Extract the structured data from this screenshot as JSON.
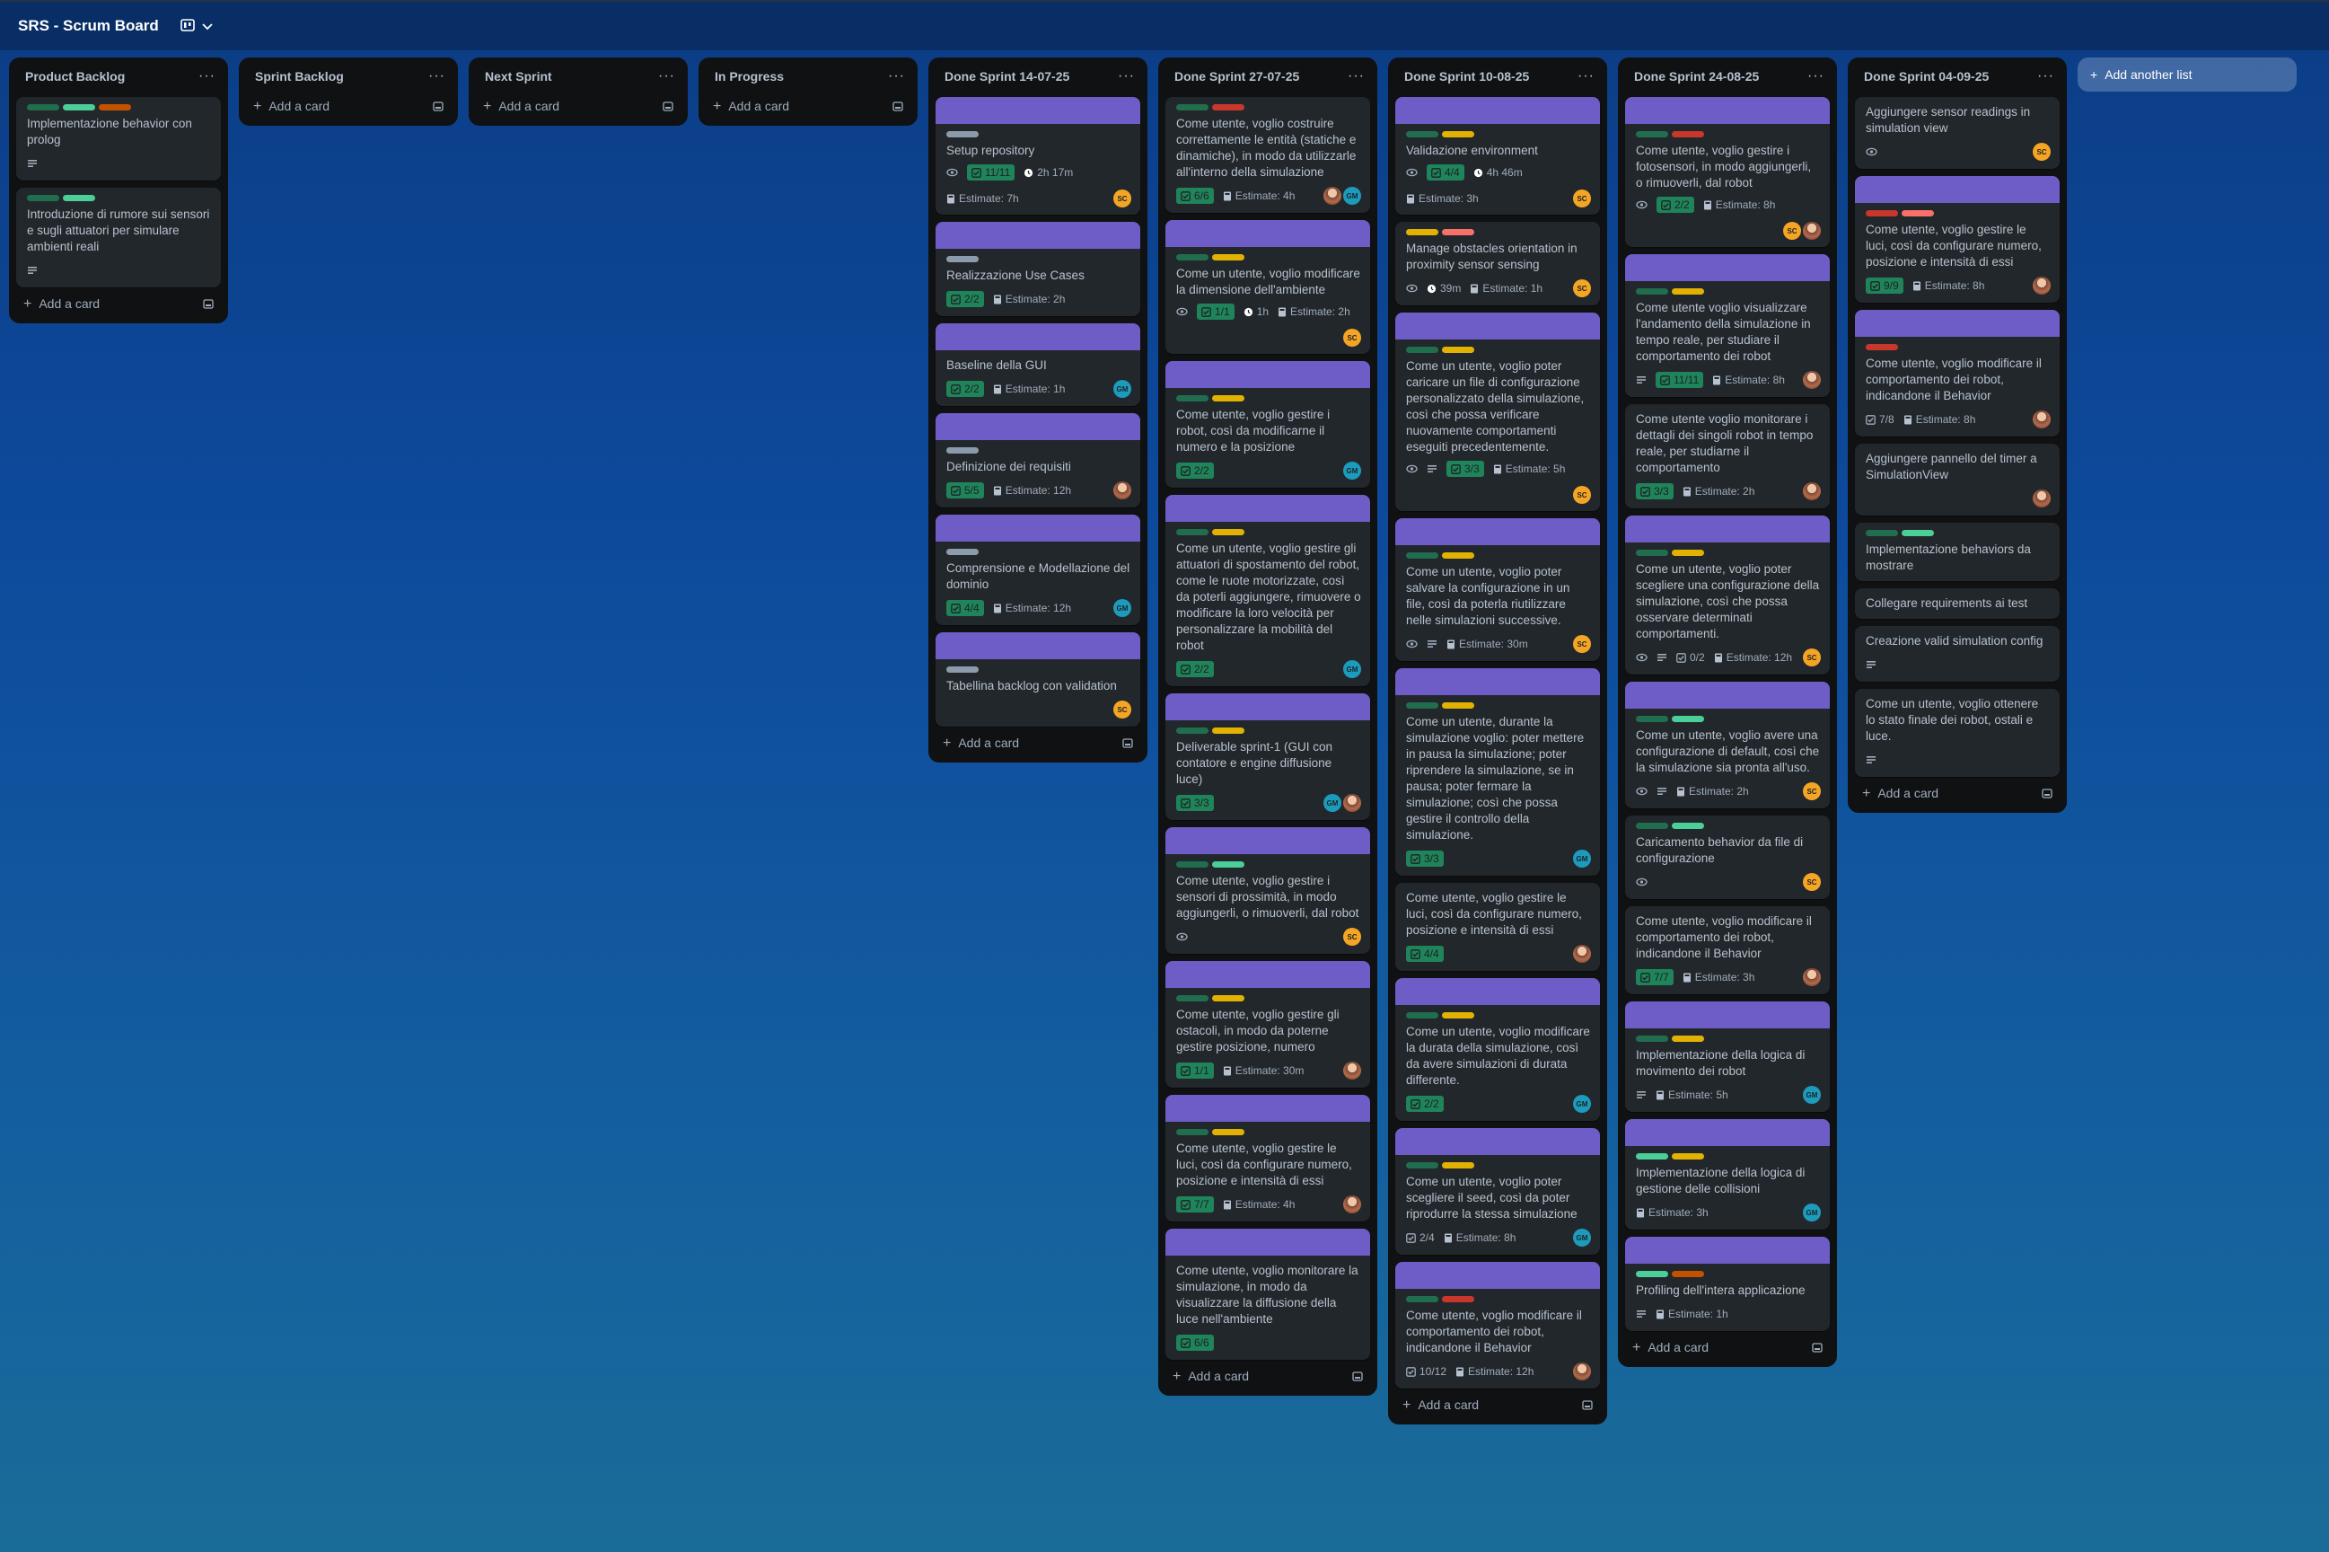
{
  "board": {
    "title": "SRS - Scrum Board",
    "view_icon": "board-icon",
    "chevron": "chevron-down-icon"
  },
  "add_card_label": "Add a card",
  "add_list_label": "Add another list",
  "estimate_prefix": "Estimate: ",
  "members": {
    "SC": {
      "initials": "SC",
      "color": "#f5a524"
    },
    "GM": {
      "initials": "GM",
      "color": "#1d9bbd"
    }
  },
  "lists": [
    {
      "title": "Product Backlog",
      "cards": [
        {
          "labels": [
            "green-d",
            "green",
            "orange"
          ],
          "title": "Implementazione behavior con prolog",
          "desc": true
        },
        {
          "labels": [
            "green-d",
            "green"
          ],
          "title": "Introduzione di rumore sui sensori e sugli attuatori per simulare ambienti reali",
          "desc": true
        }
      ]
    },
    {
      "title": "Sprint Backlog",
      "cards": []
    },
    {
      "title": "Next Sprint",
      "cards": []
    },
    {
      "title": "In Progress",
      "cards": []
    },
    {
      "title": "Done Sprint 14-07-25",
      "cards": [
        {
          "cover": true,
          "labels": [
            "gray"
          ],
          "title": "Setup repository",
          "watch": true,
          "checklist": "11/11",
          "time": "2h 17m",
          "estimate": "7h",
          "members": [
            "SC"
          ]
        },
        {
          "cover": true,
          "labels": [
            "gray"
          ],
          "title": "Realizzazione Use Cases",
          "checklist": "2/2",
          "estimate": "2h"
        },
        {
          "cover": true,
          "labels": [],
          "title": "Baseline della GUI",
          "checklist": "2/2",
          "estimate": "1h",
          "members": [
            "GM"
          ]
        },
        {
          "cover": true,
          "labels": [
            "gray"
          ],
          "title": "Definizione dei requisiti",
          "checklist": "5/5",
          "estimate": "12h",
          "members": [
            "PH"
          ]
        },
        {
          "cover": true,
          "labels": [
            "gray"
          ],
          "title": "Comprensione e Modellazione del dominio",
          "checklist": "4/4",
          "estimate": "12h",
          "members": [
            "GM"
          ]
        },
        {
          "cover": true,
          "labels": [
            "gray"
          ],
          "title": "Tabellina backlog con validation",
          "members": [
            "SC"
          ]
        }
      ]
    },
    {
      "title": "Done Sprint 27-07-25",
      "cards": [
        {
          "labels": [
            "green-d",
            "red"
          ],
          "title": "Come utente, voglio costruire correttamente le entità (statiche e dinamiche), in modo da utilizzarle all'interno della simulazione",
          "checklist": "6/6",
          "estimate": "4h",
          "members": [
            "PH",
            "GM"
          ]
        },
        {
          "cover": true,
          "labels": [
            "green-d",
            "yellow"
          ],
          "title": "Come un utente, voglio modificare la dimensione dell'ambiente",
          "watch": true,
          "checklist": "1/1",
          "time": "1h",
          "estimate": "2h",
          "members": [
            "SC"
          ]
        },
        {
          "cover": true,
          "labels": [
            "green-d",
            "yellow"
          ],
          "title": "Come utente, voglio gestire i robot, così da modificarne il numero e la posizione",
          "checklist": "2/2",
          "members": [
            "GM"
          ]
        },
        {
          "cover": true,
          "labels": [
            "green-d",
            "yellow"
          ],
          "title": "Come un utente, voglio gestire gli attuatori di spostamento del robot, come le ruote motorizzate, così da poterli aggiungere, rimuovere o modificare la loro velocità per personalizzare la mobilità del robot",
          "checklist": "2/2",
          "members": [
            "GM"
          ]
        },
        {
          "cover": true,
          "labels": [
            "green-d",
            "yellow"
          ],
          "title": "Deliverable sprint-1 (GUI con contatore e engine diffusione luce)",
          "checklist": "3/3",
          "members": [
            "GM",
            "PH"
          ]
        },
        {
          "cover": true,
          "labels": [
            "green-d",
            "green"
          ],
          "title": "Come utente, voglio gestire i sensori di prossimità, in modo aggiungerli, o rimuoverli, dal robot",
          "watch": true,
          "members": [
            "SC"
          ]
        },
        {
          "cover": true,
          "labels": [
            "green-d",
            "yellow"
          ],
          "title": "Come utente, voglio gestire gli ostacoli, in modo da poterne gestire posizione, numero",
          "checklist": "1/1",
          "estimate": "30m",
          "members": [
            "PH"
          ]
        },
        {
          "cover": true,
          "labels": [
            "green-d",
            "yellow"
          ],
          "title": "Come utente, voglio gestire le luci, così da configurare numero, posizione e intensità di essi",
          "checklist": "7/7",
          "estimate": "4h",
          "members": [
            "PH"
          ]
        },
        {
          "cover": true,
          "labels": [],
          "title": "Come utente, voglio monitorare la simulazione, in modo da visualizzare la diffusione della luce nell'ambiente",
          "checklist": "6/6"
        }
      ]
    },
    {
      "title": "Done Sprint 10-08-25",
      "cards": [
        {
          "cover": true,
          "labels": [
            "green-d",
            "yellow"
          ],
          "title": "Validazione environment",
          "watch": true,
          "checklist": "4/4",
          "time": "4h 46m",
          "estimate": "3h",
          "members": [
            "SC"
          ]
        },
        {
          "labels": [
            "yellow",
            "pink"
          ],
          "title": "Manage obstacles orientation in proximity sensor sensing",
          "watch": true,
          "time": "39m",
          "estimate": "1h",
          "members": [
            "SC"
          ]
        },
        {
          "cover": true,
          "labels": [
            "green-d",
            "yellow"
          ],
          "title": "Come un utente, voglio poter caricare un file di configurazione personalizzato della simulazione, così che possa verificare nuovamente comportamenti eseguiti precedentemente.",
          "watch": true,
          "desc": true,
          "checklist": "3/3",
          "estimate": "5h",
          "members": [
            "SC"
          ]
        },
        {
          "cover": true,
          "labels": [
            "green-d",
            "yellow"
          ],
          "title": "Come un utente, voglio poter salvare la configurazione in un file, così da poterla riutilizzare nelle simulazioni successive.",
          "watch": true,
          "desc": true,
          "estimate": "30m",
          "members": [
            "SC"
          ]
        },
        {
          "cover": true,
          "labels": [
            "green-d",
            "yellow"
          ],
          "title": "Come un utente, durante la simulazione voglio: poter mettere in pausa la simulazione; poter riprendere la simulazione, se in pausa; poter fermare la simulazione; così che possa gestire il controllo della simulazione.",
          "checklist": "3/3",
          "members": [
            "GM"
          ]
        },
        {
          "labels": [],
          "title": "Come utente, voglio gestire le luci, così da configurare numero, posizione e intensità di essi",
          "checklist": "4/4",
          "members": [
            "PH"
          ]
        },
        {
          "cover": true,
          "labels": [
            "green-d",
            "yellow"
          ],
          "title": "Come un utente, voglio modificare la durata della simulazione, così da avere simulazioni di durata differente.",
          "checklist": "2/2",
          "members": [
            "GM"
          ]
        },
        {
          "cover": true,
          "labels": [
            "green-d",
            "yellow"
          ],
          "title": "Come un utente, voglio poter scegliere il seed, così da poter riprodurre la stessa simulazione",
          "checklist_zero": "2/4",
          "estimate": "8h",
          "members": [
            "GM"
          ]
        },
        {
          "cover": true,
          "labels": [
            "green-d",
            "red"
          ],
          "title": "Come utente, voglio modificare il comportamento dei robot, indicandone il Behavior",
          "checklist_zero": "10/12",
          "estimate": "12h",
          "members": [
            "PH"
          ]
        }
      ]
    },
    {
      "title": "Done Sprint 24-08-25",
      "cards": [
        {
          "cover": true,
          "labels": [
            "green-d",
            "red"
          ],
          "title": "Come utente, voglio gestire i fotosensori, in modo aggiungerli, o rimuoverli, dal robot",
          "watch": true,
          "checklist": "2/2",
          "estimate": "8h",
          "members": [
            "SC",
            "PH"
          ]
        },
        {
          "cover": true,
          "labels": [
            "green-d",
            "yellow"
          ],
          "title": "Come utente voglio visualizzare l'andamento della simulazione in tempo reale, per studiare il comportamento dei robot",
          "desc": true,
          "checklist": "11/11",
          "estimate": "8h",
          "members": [
            "PH"
          ]
        },
        {
          "labels": [],
          "title": "Come utente voglio monitorare i dettagli dei singoli robot in tempo reale, per studiarne il comportamento",
          "checklist": "3/3",
          "estimate": "2h",
          "members": [
            "PH"
          ]
        },
        {
          "cover": true,
          "labels": [
            "green-d",
            "yellow"
          ],
          "title": "Come un utente, voglio poter scegliere una configurazione della simulazione, così che possa osservare determinati comportamenti.",
          "watch": true,
          "desc": true,
          "checklist_zero": "0/2",
          "estimate": "12h",
          "members": [
            "SC"
          ]
        },
        {
          "cover": true,
          "labels": [
            "green-d",
            "green"
          ],
          "title": "Come un utente, voglio avere una configurazione di default, così che la simulazione sia pronta all'uso.",
          "watch": true,
          "desc": true,
          "estimate": "2h",
          "members": [
            "SC"
          ]
        },
        {
          "labels": [
            "green-d",
            "green"
          ],
          "title": "Caricamento behavior da file di configurazione",
          "watch": true,
          "members": [
            "SC"
          ]
        },
        {
          "labels": [],
          "title": "Come utente, voglio modificare il comportamento dei robot, indicandone il Behavior",
          "checklist": "7/7",
          "estimate": "3h",
          "members": [
            "PH"
          ]
        },
        {
          "cover": true,
          "labels": [
            "green-d",
            "yellow"
          ],
          "title": "Implementazione della logica di movimento dei robot",
          "desc": true,
          "estimate": "5h",
          "members": [
            "GM"
          ]
        },
        {
          "cover": true,
          "labels": [
            "green",
            "yellow"
          ],
          "title": "Implementazione della logica di gestione delle collisioni",
          "estimate": "3h",
          "members": [
            "GM"
          ]
        },
        {
          "cover": true,
          "labels": [
            "green",
            "orange"
          ],
          "title": "Profiling dell'intera applicazione",
          "desc": true,
          "estimate": "1h"
        }
      ]
    },
    {
      "title": "Done Sprint 04-09-25",
      "cards": [
        {
          "labels": [],
          "title": "Aggiungere sensor readings in simulation view",
          "watch": true,
          "members": [
            "SC"
          ]
        },
        {
          "cover": true,
          "labels": [
            "red",
            "pink"
          ],
          "title": "Come utente, voglio gestire le luci, così da configurare numero, posizione e intensità di essi",
          "checklist": "9/9",
          "estimate": "8h",
          "members": [
            "PH"
          ]
        },
        {
          "cover": true,
          "labels": [
            "red"
          ],
          "title": "Come utente, voglio modificare il comportamento dei robot, indicandone il Behavior",
          "checklist_zero": "7/8",
          "estimate": "8h",
          "members": [
            "PH"
          ]
        },
        {
          "labels": [],
          "title": "Aggiungere pannello del timer a SimulationView",
          "members": [
            "PH"
          ]
        },
        {
          "labels": [
            "green-d",
            "green"
          ],
          "title": "Implementazione behaviors da mostrare"
        },
        {
          "labels": [],
          "title": "Collegare requirements ai test"
        },
        {
          "labels": [],
          "title": "Creazione valid simulation config",
          "desc": true
        },
        {
          "labels": [],
          "title": "Come un utente, voglio ottenere lo stato finale dei robot, ostali e luce.",
          "desc": true
        }
      ]
    }
  ]
}
